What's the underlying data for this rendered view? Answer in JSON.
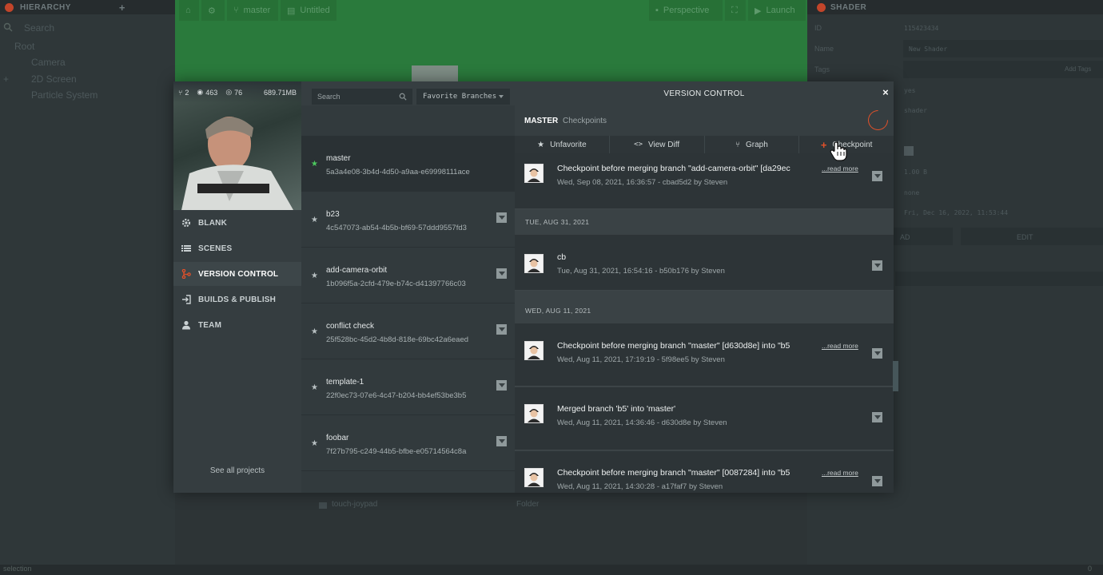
{
  "hierarchy": {
    "title": "HIERARCHY",
    "search_placeholder": "Search",
    "root": "Root",
    "items": [
      "Camera",
      "2D Screen",
      "Particle System"
    ]
  },
  "viewport_toolbar": {
    "branch": "master",
    "doc": "Untitled",
    "perspective": "Perspective",
    "launch": "Launch"
  },
  "inspector": {
    "title": "SHADER",
    "id_label": "ID",
    "id_value": "115423434",
    "name_label": "Name",
    "name_value": "New Shader",
    "tags_label": "Tags",
    "add_tags": "Add Tags",
    "v1": "yes",
    "v2": "shader",
    "size": "1.00 B",
    "none": "none",
    "date": "Fri, Dec 16, 2022, 11:53:44",
    "load_label": "AD",
    "edit_label": "EDIT"
  },
  "assets": {
    "folder_name": "touch-joypad",
    "folder_type": "Folder"
  },
  "statusbar": {
    "text": "selection",
    "count": "0"
  },
  "user_stats": {
    "forks": "2",
    "views": "463",
    "watchers": "76",
    "size": "689.71MB"
  },
  "sidebar": {
    "nav": [
      {
        "label": "BLANK",
        "icon": "gear-icon"
      },
      {
        "label": "SCENES",
        "icon": "list-icon"
      },
      {
        "label": "VERSION CONTROL",
        "icon": "branch-icon"
      },
      {
        "label": "BUILDS & PUBLISH",
        "icon": "publish-icon"
      },
      {
        "label": "TEAM",
        "icon": "user-icon"
      }
    ],
    "see_all": "See all projects"
  },
  "modal": {
    "title": "VERSION CONTROL",
    "close": "×",
    "search_placeholder": "Search",
    "favorite_filter": "Favorite Branches",
    "current_branch": "MASTER",
    "current_view": "Checkpoints",
    "actions": [
      "Unfavorite",
      "View Diff",
      "Graph",
      "Checkpoint"
    ]
  },
  "branches": [
    {
      "name": "master",
      "hash": "5a3a4e08-3b4d-4d50-a9aa-e69998111ace"
    },
    {
      "name": "b23",
      "hash": "4c547073-ab54-4b5b-bf69-57ddd9557fd3"
    },
    {
      "name": "add-camera-orbit",
      "hash": "1b096f5a-2cfd-479e-b74c-d41397766c03"
    },
    {
      "name": "conflict check",
      "hash": "25f528bc-45d2-4b8d-818e-69bc42a6eaed"
    },
    {
      "name": "template-1",
      "hash": "22f0ec73-07e6-4c47-b204-bb4ef53be3b5"
    },
    {
      "name": "foobar",
      "hash": "7f27b795-c249-44b5-bfbe-e05714564c8a"
    }
  ],
  "timeline": {
    "read_more": "...read more",
    "days": [
      "TUE, AUG 31, 2021",
      "WED, AUG 11, 2021"
    ],
    "checkpoints": [
      {
        "title": "Checkpoint before merging branch \"add-camera-orbit\" [da29ec",
        "meta": "Wed, Sep 08, 2021, 16:36:57 - cbad5d2 by Steven"
      },
      {
        "title": "cb",
        "meta": "Tue, Aug 31, 2021, 16:54:16 - b50b176 by Steven"
      },
      {
        "title": "Checkpoint before merging branch \"master\" [d630d8e] into \"b5",
        "meta": "Wed, Aug 11, 2021, 17:19:19 - 5f98ee5 by Steven"
      },
      {
        "title": "Merged branch 'b5' into 'master'",
        "meta": "Wed, Aug 11, 2021, 14:36:46 - d630d8e by Steven"
      },
      {
        "title": "Checkpoint before merging branch \"master\" [0087284] into \"b5",
        "meta": "Wed, Aug 11, 2021, 14:30:28 - a17faf7 by Steven"
      }
    ]
  },
  "colors": {
    "accent": "#e2512a",
    "favorite_star": "#4cc95e",
    "viewport": "#2a7a3c"
  }
}
